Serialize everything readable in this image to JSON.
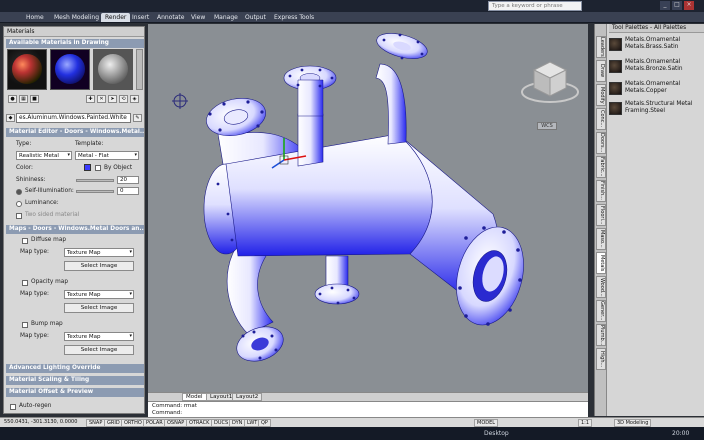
{
  "title_bar": {
    "search_placeholder": "Type a keyword or phrase"
  },
  "ribbon": {
    "tabs": [
      "Home",
      "Mesh Modeling",
      "Render",
      "Insert",
      "Annotate",
      "View",
      "Manage",
      "Output",
      "Express Tools"
    ]
  },
  "materials_palette": {
    "title": "Materials",
    "available_header": "Available Materials in Drawing",
    "material_name": "es.Aluminum.Windows.Painted.White",
    "editor_header": "Material Editor - Doors - Windows.Metal....",
    "type_label": "Type:",
    "template_label": "Template:",
    "type_value": "Realistic Metal",
    "template_value": "Metal - Flat",
    "color_label": "Color:",
    "by_object": "By Object",
    "shininess_label": "Shininess:",
    "shininess_value": "20",
    "self_illum_label": "Self-Illumination:",
    "self_illum_value": "0",
    "luminance_label": "Luminance:",
    "two_sided": "Two sided material",
    "maps_header": "Maps - Doors - Windows.Metal Doors an...",
    "diffuse_map": "Diffuse map",
    "opacity_map": "Opacity map",
    "bump_map": "Bump map",
    "map_type_label": "Map type:",
    "map_type_value": "Texture Map",
    "select_image": "Select Image",
    "advanced_lighting": "Advanced Lighting Override",
    "material_scaling": "Material Scaling & Tiling",
    "material_offset": "Material Offset & Preview",
    "auto_regen": "Auto-regen"
  },
  "viewport": {
    "view_label": "WCS"
  },
  "tool_palettes": {
    "title": "Tool Palettes - All Palettes",
    "tabs": [
      "Leaders",
      "Draw",
      "Modify",
      "Conc...",
      "Doors...",
      "Fabric...",
      "Finish...",
      "Floori...",
      "Maso...",
      "Metals",
      "Wood...",
      "Gener...",
      "Plumb...",
      "High..."
    ],
    "items": [
      "Metals.Ornamental Metals.Brass.Satin",
      "Metals.Ornamental Metals.Bronze.Satin",
      "Metals.Ornamental Metals.Copper",
      "Metals.Structural Metal Framing.Steel"
    ]
  },
  "layout_tabs": [
    "Model",
    "Layout1",
    "Layout2"
  ],
  "command_lines": [
    "Command: rmat",
    "Command:"
  ],
  "status_bar": {
    "coords": "550.0431, -301.3130, 0.0000",
    "toggles": [
      "SNAP",
      "GRID",
      "ORTHO",
      "POLAR",
      "OSNAP",
      "OTRACK",
      "DUCS",
      "DYN",
      "LWT",
      "QP"
    ],
    "right": [
      "MODEL",
      "1:1",
      "3D Modeling"
    ]
  },
  "taskbar": {
    "desktop": "Desktop",
    "time": "20:00"
  },
  "colors": {
    "accent": "#3b3bff",
    "section": "#8c9bb2",
    "viewport_bg": "#8a8f94"
  }
}
